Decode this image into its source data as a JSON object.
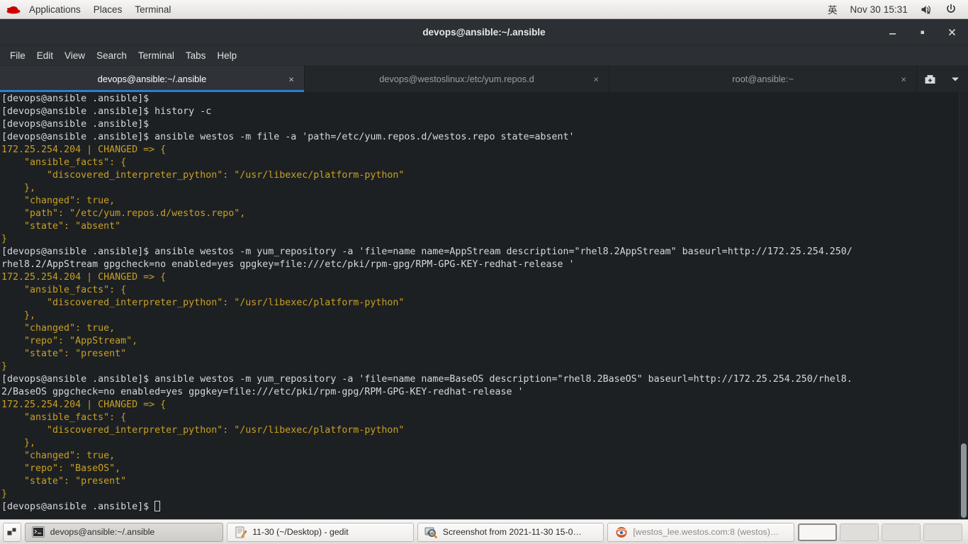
{
  "top_panel": {
    "logo_icon": "redhat-logo-icon",
    "menus": [
      "Applications",
      "Places",
      "Terminal"
    ],
    "input_method": "英",
    "clock": "Nov 30  15:31",
    "volume_icon": "speaker-muted-icon",
    "power_icon": "power-icon"
  },
  "window": {
    "title": "devops@ansible:~/.ansible",
    "controls": {
      "minimize": "_",
      "maximize": "▫",
      "close": "✕"
    },
    "menubar": [
      "File",
      "Edit",
      "View",
      "Search",
      "Terminal",
      "Tabs",
      "Help"
    ]
  },
  "tabs": {
    "items": [
      {
        "label": "devops@ansible:~/.ansible",
        "active": true,
        "close": "×"
      },
      {
        "label": "devops@westoslinux:/etc/yum.repos.d",
        "active": false,
        "close": "×"
      },
      {
        "label": "root@ansible:~",
        "active": false,
        "close": "×"
      }
    ],
    "new_tab_icon": "new-tab-icon",
    "dropdown_icon": "chevron-down-icon"
  },
  "terminal": {
    "prompt": "[devops@ansible .ansible]$ ",
    "lines": [
      {
        "text": "[devops@ansible .ansible]$",
        "color": "white"
      },
      {
        "text": "[devops@ansible .ansible]$ history -c",
        "color": "white"
      },
      {
        "text": "[devops@ansible .ansible]$",
        "color": "white"
      },
      {
        "text": "[devops@ansible .ansible]$ ansible westos -m file -a 'path=/etc/yum.repos.d/westos.repo state=absent'",
        "color": "white"
      },
      {
        "text": "172.25.254.204 | CHANGED => {",
        "color": "yellow"
      },
      {
        "text": "    \"ansible_facts\": {",
        "color": "yellow"
      },
      {
        "text": "        \"discovered_interpreter_python\": \"/usr/libexec/platform-python\"",
        "color": "yellow"
      },
      {
        "text": "    },",
        "color": "yellow"
      },
      {
        "text": "    \"changed\": true,",
        "color": "yellow"
      },
      {
        "text": "    \"path\": \"/etc/yum.repos.d/westos.repo\",",
        "color": "yellow"
      },
      {
        "text": "    \"state\": \"absent\"",
        "color": "yellow"
      },
      {
        "text": "}",
        "color": "yellow"
      },
      {
        "text": "[devops@ansible .ansible]$ ansible westos -m yum_repository -a 'file=name name=AppStream description=\"rhel8.2AppStream\" baseurl=http://172.25.254.250/",
        "color": "white"
      },
      {
        "text": "rhel8.2/AppStream gpgcheck=no enabled=yes gpgkey=file:///etc/pki/rpm-gpg/RPM-GPG-KEY-redhat-release '",
        "color": "white"
      },
      {
        "text": "172.25.254.204 | CHANGED => {",
        "color": "yellow"
      },
      {
        "text": "    \"ansible_facts\": {",
        "color": "yellow"
      },
      {
        "text": "        \"discovered_interpreter_python\": \"/usr/libexec/platform-python\"",
        "color": "yellow"
      },
      {
        "text": "    },",
        "color": "yellow"
      },
      {
        "text": "    \"changed\": true,",
        "color": "yellow"
      },
      {
        "text": "    \"repo\": \"AppStream\",",
        "color": "yellow"
      },
      {
        "text": "    \"state\": \"present\"",
        "color": "yellow"
      },
      {
        "text": "}",
        "color": "yellow"
      },
      {
        "text": "[devops@ansible .ansible]$ ansible westos -m yum_repository -a 'file=name name=BaseOS description=\"rhel8.2BaseOS\" baseurl=http://172.25.254.250/rhel8.",
        "color": "white"
      },
      {
        "text": "2/BaseOS gpgcheck=no enabled=yes gpgkey=file:///etc/pki/rpm-gpg/RPM-GPG-KEY-redhat-release '",
        "color": "white"
      },
      {
        "text": "172.25.254.204 | CHANGED => {",
        "color": "yellow"
      },
      {
        "text": "    \"ansible_facts\": {",
        "color": "yellow"
      },
      {
        "text": "        \"discovered_interpreter_python\": \"/usr/libexec/platform-python\"",
        "color": "yellow"
      },
      {
        "text": "    },",
        "color": "yellow"
      },
      {
        "text": "    \"changed\": true,",
        "color": "yellow"
      },
      {
        "text": "    \"repo\": \"BaseOS\",",
        "color": "yellow"
      },
      {
        "text": "    \"state\": \"present\"",
        "color": "yellow"
      },
      {
        "text": "}",
        "color": "yellow"
      }
    ],
    "colors": {
      "background": "#1d2023",
      "foreground": "#d6d9db",
      "output": "#c7a022",
      "tab_accent": "#2a7fd4"
    }
  },
  "taskbar": {
    "show_desktop_icon": "show-desktop-icon",
    "tasks": [
      {
        "label": "devops@ansible:~/.ansible",
        "icon": "terminal-icon",
        "state": "active"
      },
      {
        "label": "11-30 (~/Desktop) - gedit",
        "icon": "gedit-icon",
        "state": "idle"
      },
      {
        "label": "Screenshot from 2021-11-30 15-0…",
        "icon": "image-viewer-icon",
        "state": "idle"
      },
      {
        "label": "[westos_lee.westos.com:8 (westos)…",
        "icon": "vnc-icon",
        "state": "dim"
      }
    ],
    "workspaces": [
      {
        "active": true
      },
      {
        "active": false
      },
      {
        "active": false
      },
      {
        "active": false
      }
    ]
  }
}
